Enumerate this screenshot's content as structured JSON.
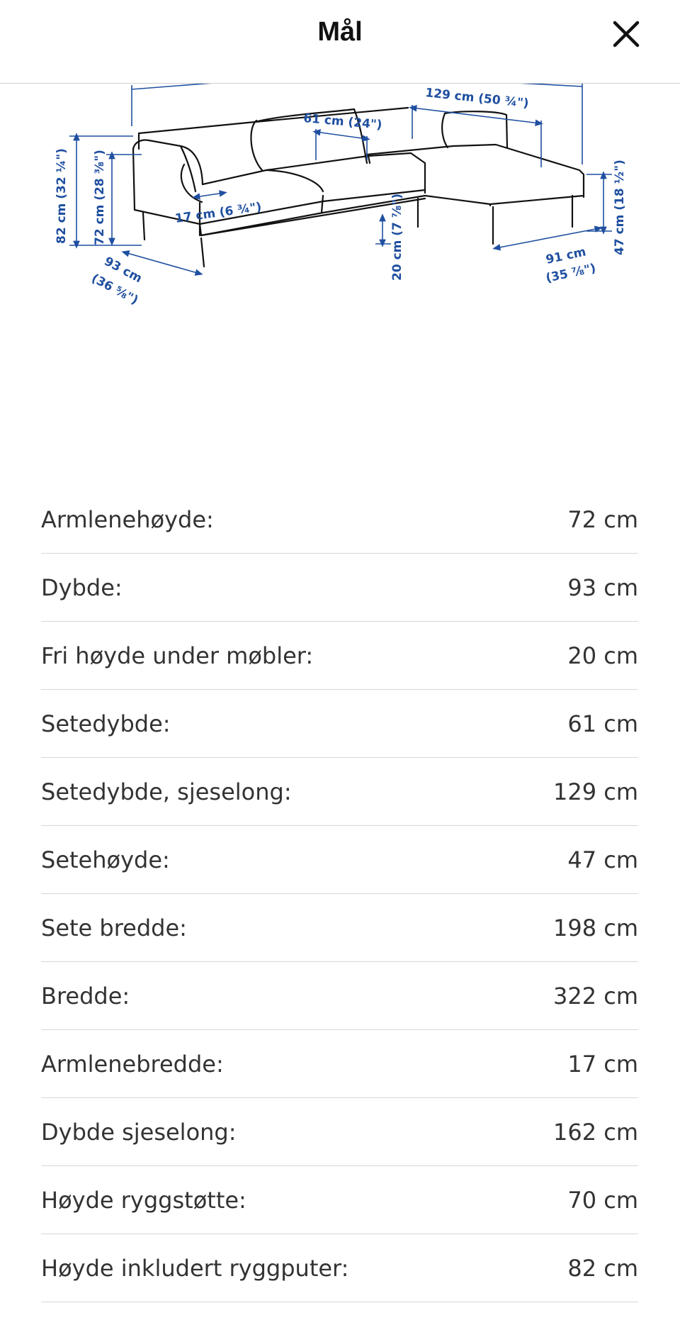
{
  "header": {
    "title": "Mål",
    "close_icon": "close-icon"
  },
  "diagram": {
    "labels": {
      "depth_seat_chaise": "129 cm (50 ¾\")",
      "seat_depth": "61 cm (24\")",
      "height_cushions": "82 cm (32 ¼\")",
      "armrest_height": "72 cm (28 ⅜\")",
      "armrest_width": "17 cm (6 ¾\")",
      "depth_cm": "93 cm",
      "depth_in": "(36 ⅝\")",
      "free_height": "20 cm (7 ⅞\")",
      "chaise_depth_cm": "91 cm",
      "chaise_depth_in": "(35 ⅞\")",
      "seat_height": "47 cm (18 ½\")"
    }
  },
  "specs": [
    {
      "label": "Armlenehøyde:",
      "value": "72 cm"
    },
    {
      "label": "Dybde:",
      "value": "93 cm"
    },
    {
      "label": "Fri høyde under møbler:",
      "value": "20 cm"
    },
    {
      "label": "Setedybde:",
      "value": "61 cm"
    },
    {
      "label": "Setedybde, sjeselong:",
      "value": "129 cm"
    },
    {
      "label": "Setehøyde:",
      "value": "47 cm"
    },
    {
      "label": "Sete bredde:",
      "value": "198 cm"
    },
    {
      "label": "Bredde:",
      "value": "322 cm"
    },
    {
      "label": "Armlenebredde:",
      "value": "17 cm"
    },
    {
      "label": "Dybde sjeselong:",
      "value": "162 cm"
    },
    {
      "label": "Høyde ryggstøtte:",
      "value": "70 cm"
    },
    {
      "label": "Høyde inkludert ryggputer:",
      "value": "82 cm"
    }
  ],
  "colors": {
    "dimension_blue": "#1f4fa0",
    "divider": "#d7d7d7"
  }
}
